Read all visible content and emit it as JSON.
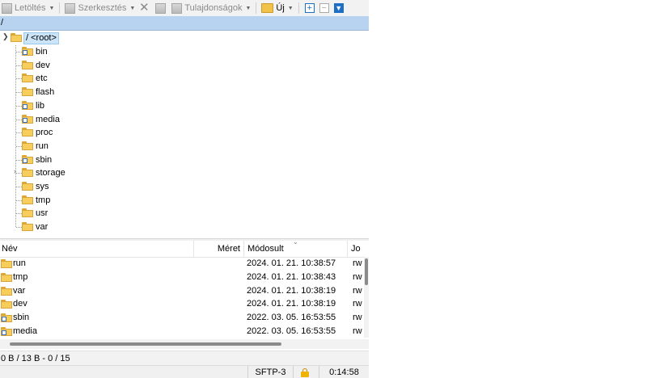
{
  "toolbar": {
    "download_label": "Letöltés",
    "edit_label": "Szerkesztés",
    "properties_label": "Tulajdonságok",
    "new_label": "Új"
  },
  "path": "/",
  "tree": {
    "root_label": "/ <root>",
    "items": [
      {
        "label": "bin",
        "link": true
      },
      {
        "label": "dev",
        "link": false
      },
      {
        "label": "etc",
        "link": false
      },
      {
        "label": "flash",
        "link": false
      },
      {
        "label": "lib",
        "link": true
      },
      {
        "label": "media",
        "link": true
      },
      {
        "label": "proc",
        "link": false
      },
      {
        "label": "run",
        "link": false
      },
      {
        "label": "sbin",
        "link": true
      },
      {
        "label": "storage",
        "link": false,
        "collapsed": true
      },
      {
        "label": "sys",
        "link": false
      },
      {
        "label": "tmp",
        "link": false
      },
      {
        "label": "usr",
        "link": false
      },
      {
        "label": "var",
        "link": false
      }
    ]
  },
  "file_list": {
    "columns": {
      "name": "Név",
      "size": "Méret",
      "modified": "Módosult",
      "rights": "Jo"
    },
    "rows": [
      {
        "name": "run",
        "modified": "2024. 01. 21. 10:38:57",
        "rights": "rw",
        "link": false
      },
      {
        "name": "tmp",
        "modified": "2024. 01. 21. 10:38:43",
        "rights": "rw",
        "link": false
      },
      {
        "name": "var",
        "modified": "2024. 01. 21. 10:38:19",
        "rights": "rw",
        "link": false
      },
      {
        "name": "dev",
        "modified": "2024. 01. 21. 10:38:19",
        "rights": "rw",
        "link": false
      },
      {
        "name": "sbin",
        "modified": "2022. 03. 05. 16:53:55",
        "rights": "rw",
        "link": true
      },
      {
        "name": "media",
        "modified": "2022. 03. 05. 16:53:55",
        "rights": "rw",
        "link": true
      }
    ]
  },
  "status": {
    "selection": "0 B / 13 B - 0 / 15",
    "protocol": "SFTP-3",
    "elapsed": "0:14:58"
  },
  "colors": {
    "accent": "#1c6fc4",
    "path_bar": "#b7d3ef",
    "folder": "#f7cd5b",
    "lock": "#f0b400"
  }
}
